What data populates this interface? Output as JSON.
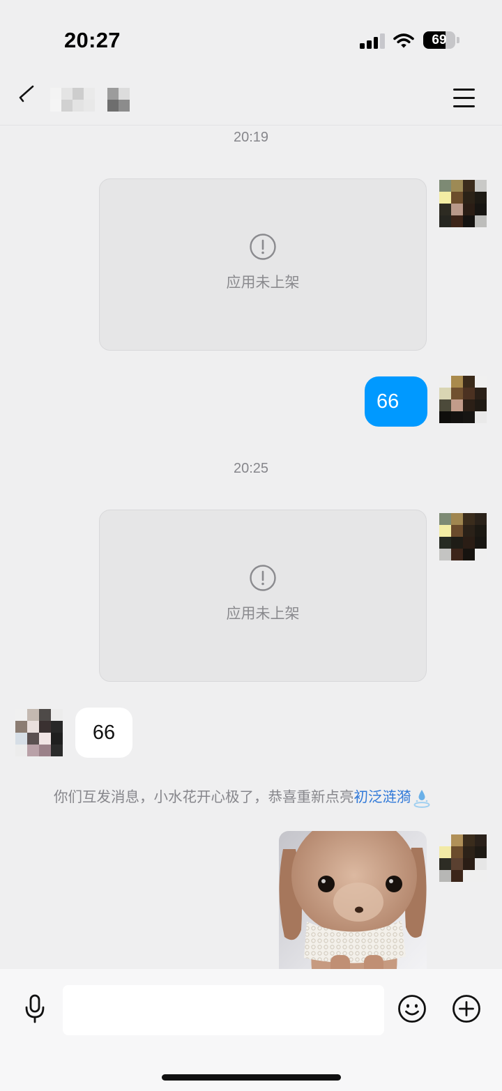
{
  "status_bar": {
    "time": "20:27",
    "battery_level": "69",
    "signal_level": 3,
    "icons": [
      "cellular-signal-icon",
      "wifi-icon",
      "battery-icon"
    ]
  },
  "header": {
    "back_icon": "chevron-left-icon",
    "menu_icon": "hamburger-menu-icon"
  },
  "chat": {
    "timestamp_1": "20:19",
    "sent_card_1": {
      "icon": "exclamation-circle-icon",
      "text": "应用未上架"
    },
    "sent_text_1": "66",
    "timestamp_2": "20:25",
    "sent_card_2": {
      "icon": "exclamation-circle-icon",
      "text": "应用未上架"
    },
    "received_text_1": "66",
    "system_notice": {
      "text": "你们互发消息，小水花开心极了，恭喜重新点亮",
      "link_text": "初泛涟漪",
      "icon": "water-splash-icon"
    }
  },
  "input_bar": {
    "voice_icon": "microphone-icon",
    "text_value": "",
    "emoji_icon": "smiley-face-icon",
    "more_icon": "plus-circle-icon"
  },
  "colors": {
    "background": "#efeff0",
    "outgoing_bubble": "#0099ff",
    "incoming_bubble": "#ffffff",
    "card_background": "#e6e6e7",
    "link": "#2f78d8",
    "meta_text": "#86868b"
  }
}
